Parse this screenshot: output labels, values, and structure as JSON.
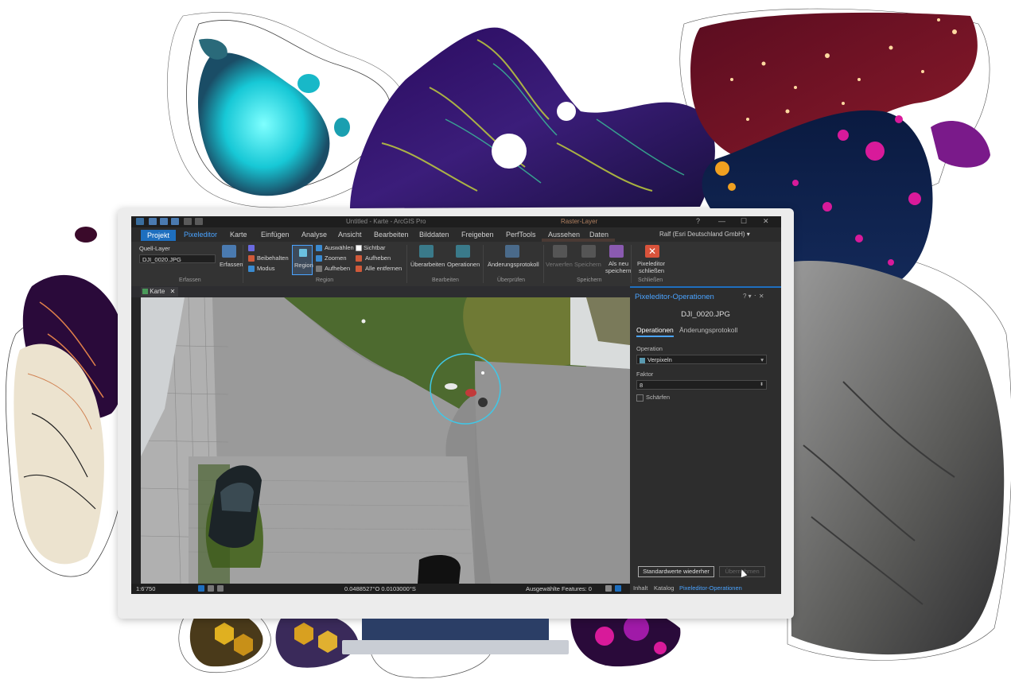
{
  "app": {
    "title": "Untitled - Karte - ArcGIS Pro",
    "context_title": "Raster-Layer",
    "user": "Ralf (Esri Deutschland GmbH) ▾",
    "window_controls": {
      "help": "?",
      "minimize": "—",
      "maximize": "☐",
      "close": "✕"
    }
  },
  "ribbon_tabs": [
    "Projekt",
    "Pixeleditor",
    "Karte",
    "Einfügen",
    "Analyse",
    "Ansicht",
    "Bearbeiten",
    "Bilddaten",
    "Freigeben",
    "PerfTools",
    "Aussehen",
    "Daten"
  ],
  "active_tab": "Pixeleditor",
  "ribbon": {
    "erfassen": {
      "quell_layer_label": "Quell-Layer",
      "quell_layer_value": "DJI_0020.JPG",
      "erfassen_button": "Erfassen",
      "group_label": "Erfassen"
    },
    "region": {
      "beibehalten": "Beibehalten",
      "modus": "Modus",
      "region_button": "Region",
      "auswaehlen": "Auswählen",
      "zoomen": "Zoomen",
      "aufheben": "Aufheben",
      "sichtbar": "Sichtbar",
      "aufheben2": "Aufheben",
      "alle_entfernen": "Alle entfernen",
      "group_label": "Region"
    },
    "bearbeiten": {
      "ueberarbeiten": "Überarbeiten",
      "operationen": "Operationen",
      "group_label": "Bearbeiten"
    },
    "ueberpruefen": {
      "aenderungsprotokoll": "Änderungsprotokoll",
      "group_label": "Überprüfen"
    },
    "speichern": {
      "verwerfen": "Verwerfen",
      "speichern": "Speichern",
      "als_neu_speichern_1": "Als neu",
      "als_neu_speichern_2": "speichern",
      "group_label": "Speichern"
    },
    "schliessen": {
      "pixeleditor_schliessen_1": "Pixeleditor",
      "pixeleditor_schliessen_2": "schließen",
      "group_label": "Schließen"
    }
  },
  "map_view": {
    "tab_label": "Karte",
    "scale": "1:6'750",
    "coordinates": "0.0488527°O 0.0103000°S",
    "selected_features": "Ausgewählte Features: 0"
  },
  "pane": {
    "title": "Pixeleditor-Operationen",
    "controls": "? ▾ ᛫ ✕",
    "layer_name": "DJI_0020.JPG",
    "tabs": [
      "Operationen",
      "Änderungsprotokoll"
    ],
    "operation_label": "Operation",
    "operation_value": "Verpixeln",
    "faktor_label": "Faktor",
    "faktor_value": "8",
    "schaerfen_label": "Schärfen",
    "defaults_button": "Standardwerte wiederher",
    "apply_button": "Übernehmen",
    "bottom_tabs": [
      "Inhalt",
      "Katalog",
      "Pixeleditor-Operationen"
    ]
  },
  "colors": {
    "accent": "#4aa3ff",
    "projekt_tab": "#1e6fbf",
    "screen_bg": "#252526",
    "close_icon": "#d9533b"
  }
}
